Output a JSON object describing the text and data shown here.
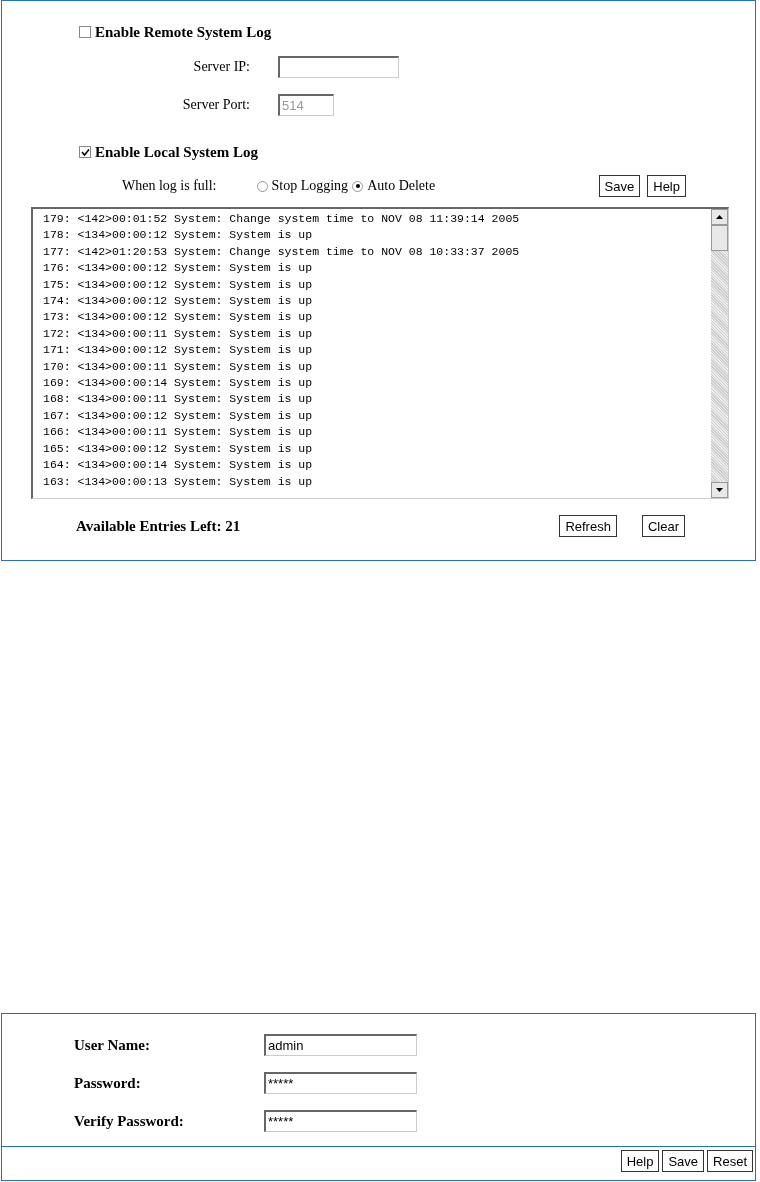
{
  "remote_log": {
    "label": "Enable Remote System Log",
    "checked": false,
    "server_ip": {
      "label": "Server IP:"
    },
    "server_port": {
      "label": "Server Port:",
      "value": "514",
      "disabled": true
    }
  },
  "local_log": {
    "label": "Enable Local System Log",
    "checked": true,
    "when_full_label": "When log is full:",
    "options": [
      {
        "label": "Stop Logging",
        "selected": false
      },
      {
        "label": "Auto Delete",
        "selected": true
      }
    ],
    "buttons": [
      "Save",
      "Help"
    ]
  },
  "log_lines": [
    "179: <142>00:01:52 System: Change system time to NOV 08 11:39:14 2005",
    "178: <134>00:00:12 System: System is up",
    "177: <142>01:20:53 System: Change system time to NOV 08 10:33:37 2005",
    "176: <134>00:00:12 System: System is up",
    "175: <134>00:00:12 System: System is up",
    "174: <134>00:00:12 System: System is up",
    "173: <134>00:00:12 System: System is up",
    "172: <134>00:00:11 System: System is up",
    "171: <134>00:00:12 System: System is up",
    "170: <134>00:00:11 System: System is up",
    "169: <134>00:00:14 System: System is up",
    "168: <134>00:00:11 System: System is up",
    "167: <134>00:00:12 System: System is up",
    "166: <134>00:00:11 System: System is up",
    "165: <134>00:00:12 System: System is up",
    "164: <134>00:00:14 System: System is up",
    "163: <134>00:00:13 System: System is up"
  ],
  "entries_left": "Available Entries Left: 21",
  "log_buttons": [
    "Refresh",
    "Clear"
  ],
  "account": {
    "fields": [
      {
        "label": "User Name:",
        "value": "admin"
      },
      {
        "label": "Password:",
        "value": "*****"
      },
      {
        "label": "Verify Password:",
        "value": "*****"
      }
    ],
    "buttons": [
      "Help",
      "Save",
      "Reset"
    ]
  }
}
